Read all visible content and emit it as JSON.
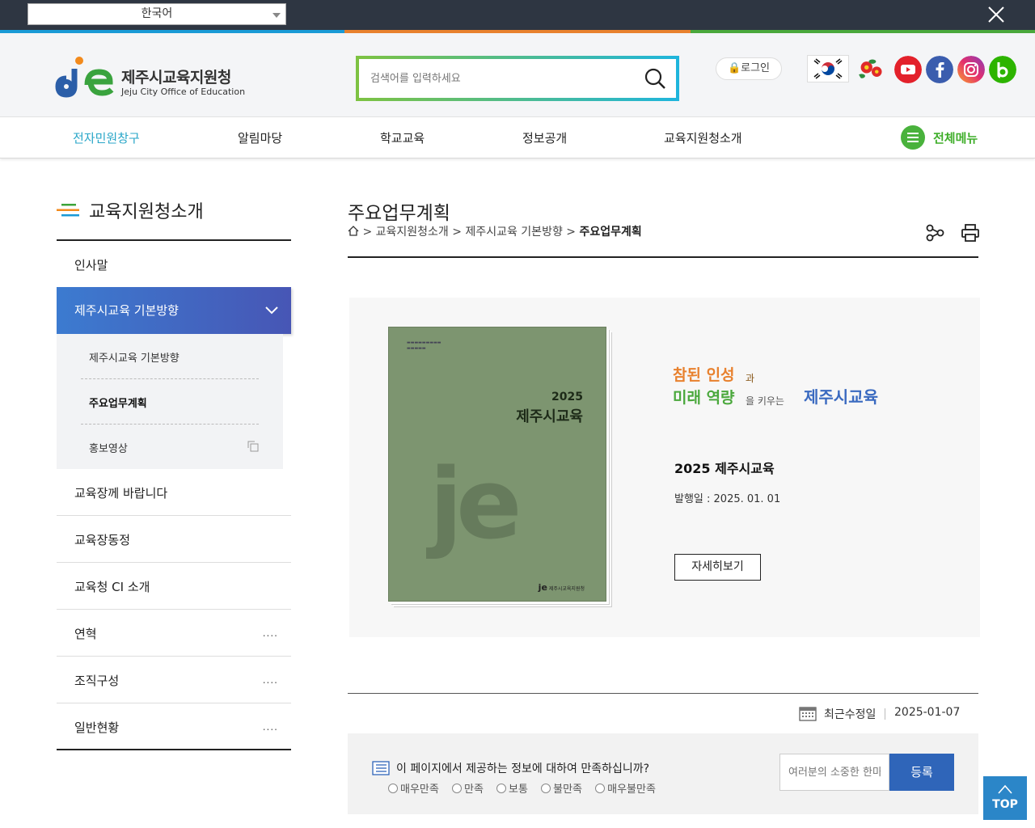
{
  "topbar": {
    "language_selected": "한국어",
    "colors": [
      "#1a9ad6",
      "#e8812e",
      "#4aa83c"
    ]
  },
  "header": {
    "logo_title": "제주시교육지원청",
    "logo_subtitle": "Jeju City Office of Education",
    "search_placeholder": "검색어를 입력하세요",
    "login_label": "로그인",
    "social_icons": [
      "korea-flag-icon",
      "camellia-icon",
      "youtube-icon",
      "facebook-icon",
      "instagram-icon",
      "blog-icon"
    ]
  },
  "gnb": {
    "items": [
      "전자민원창구",
      "알림마당",
      "학교교육",
      "정보공개",
      "교육지원청소개"
    ],
    "all_menu_label": "전체메뉴"
  },
  "sidebar": {
    "title": "교육지원청소개",
    "items": [
      {
        "label": "인사말"
      },
      {
        "label": "제주시교육 기본방향",
        "active": true
      },
      {
        "label": "교육장께 바랍니다"
      },
      {
        "label": "교육장동정"
      },
      {
        "label": "교육청 CI 소개"
      },
      {
        "label": "연혁",
        "more": "...."
      },
      {
        "label": "조직구성",
        "more": "...."
      },
      {
        "label": "일반현황",
        "more": "...."
      }
    ],
    "subitems": [
      {
        "label": "제주시교육 기본방향"
      },
      {
        "label": "주요업무계획",
        "current": true
      },
      {
        "label": "홍보영상",
        "external": true
      }
    ]
  },
  "content": {
    "page_title": "주요업무계획",
    "breadcrumb": {
      "sep": ">",
      "items": [
        "교육지원청소개",
        "제주시교육 기본방향",
        "주요업무계획"
      ]
    },
    "book": {
      "year": "2025",
      "title": "제주시교육",
      "logo_text": "제주시교육지원청"
    },
    "slogan": {
      "line1_a": "참된 인성",
      "line1_b": "과",
      "line2_a": "미래 역량",
      "line2_b": "을 키우는",
      "line2_c": "제주시교육"
    },
    "info_title": "2025 제주시교육",
    "info_date": "발행일 : 2025. 01. 01",
    "detail_button": "자세히보기"
  },
  "footer_info": {
    "updated_label": "최근수정일",
    "updated_value": "2025-01-07"
  },
  "survey": {
    "question": "이 페이지에서 제공하는 정보에 대하여 만족하십니까?",
    "options": [
      "매우만족",
      "만족",
      "보통",
      "불만족",
      "매우불만족"
    ],
    "opinion_placeholder": "여러분의 소중한 한마디",
    "submit_label": "등록"
  },
  "top_button": "TOP"
}
